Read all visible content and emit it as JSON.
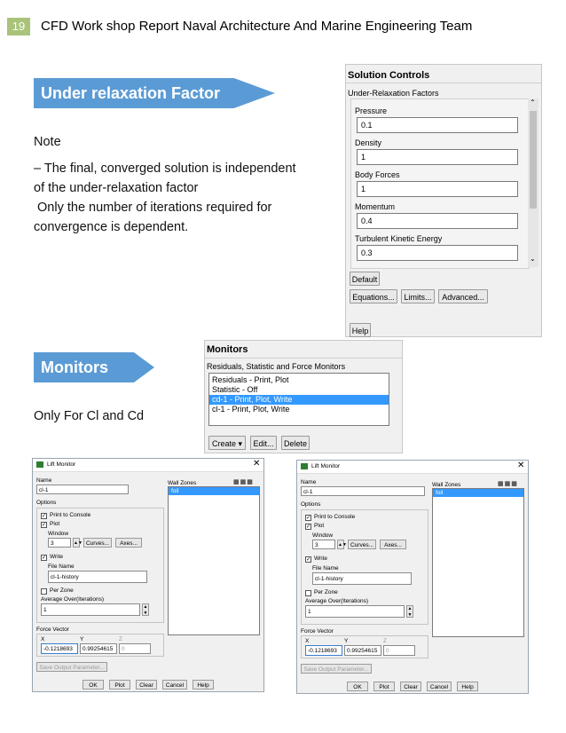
{
  "header": {
    "page_number": "19",
    "title": "CFD Work shop Report Naval Architecture And Marine Engineering Team"
  },
  "section1": {
    "banner": "Under relaxation Factor",
    "note_label": "Note",
    "lines": [
      "– The final, converged solution is independent",
      "of the under-relaxation factor",
      " Only the number of iterations required for",
      "convergence is dependent."
    ]
  },
  "solution_controls": {
    "title": "Solution Controls",
    "group_label": "Under-Relaxation Factors",
    "fields": [
      {
        "label": "Pressure",
        "value": "0.1"
      },
      {
        "label": "Density",
        "value": "1"
      },
      {
        "label": "Body Forces",
        "value": "1"
      },
      {
        "label": "Momentum",
        "value": "0.4"
      },
      {
        "label": "Turbulent Kinetic Energy",
        "value": "0.3"
      }
    ],
    "default_button": "Default",
    "equations_button": "Equations...",
    "limits_button": "Limits...",
    "advanced_button": "Advanced...",
    "help_button": "Help"
  },
  "section2": {
    "banner": "Monitors",
    "text": "Only For Cl and Cd"
  },
  "monitors": {
    "title": "Monitors",
    "list_label": "Residuals, Statistic and Force Monitors",
    "items": [
      "Residuals - Print, Plot",
      "Statistic - Off",
      "cd-1 - Print, Plot, Write",
      "cl-1 - Print, Plot, Write"
    ],
    "selected_index": 2,
    "create_button": "Create",
    "edit_button": "Edit...",
    "delete_button": "Delete"
  },
  "lift_monitor": {
    "title": "Lift Monitor",
    "name_label": "Name",
    "name_value": "cl-1",
    "options_label": "Options",
    "print_label": "Print to Console",
    "plot_label": "Plot",
    "window_label": "Window",
    "window_value": "3",
    "curves_button": "Curves...",
    "axes_button": "Axes...",
    "write_label": "Write",
    "file_name_label": "File Name",
    "file_name_value": "cl-1-history",
    "per_zone_label": "Per Zone",
    "average_label": "Average Over(Iterations)",
    "average_value": "1",
    "force_vector_label": "Force Vector",
    "x_label": "X",
    "y_label": "Y",
    "z_label": "Z",
    "x_value": "-0.1218693",
    "y_value": "0.99254615",
    "z_value": "0",
    "save_output_button": "Save Output Parameter...",
    "wall_zones_label": "Wall Zones",
    "wall_zone_item": "foil",
    "ok_button": "OK",
    "plot_button": "Plot",
    "clear_button": "Clear",
    "cancel_button": "Cancel",
    "help_button": "Help"
  }
}
